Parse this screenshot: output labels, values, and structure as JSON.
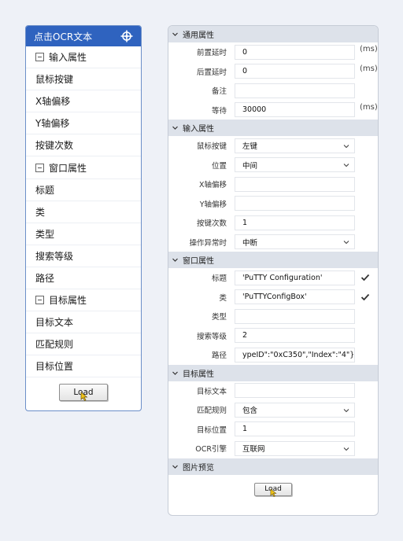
{
  "left": {
    "title": "点击OCR文本",
    "rows": [
      {
        "label": "输入属性",
        "group": true
      },
      {
        "label": "鼠标按键"
      },
      {
        "label": "X轴偏移"
      },
      {
        "label": "Y轴偏移"
      },
      {
        "label": "按键次数"
      },
      {
        "label": "窗口属性",
        "group": true
      },
      {
        "label": "标题"
      },
      {
        "label": "类"
      },
      {
        "label": "类型"
      },
      {
        "label": "搜索等级"
      },
      {
        "label": "路径"
      },
      {
        "label": "目标属性",
        "group": true
      },
      {
        "label": "目标文本"
      },
      {
        "label": "匹配规则"
      },
      {
        "label": "目标位置"
      }
    ],
    "load_label": "Load"
  },
  "right": {
    "sections": [
      {
        "title": "通用属性",
        "rows": [
          {
            "label": "前置延时",
            "value": "0",
            "unit": "(ms)"
          },
          {
            "label": "后置延时",
            "value": "0",
            "unit": "(ms)"
          },
          {
            "label": "备注",
            "value": ""
          },
          {
            "label": "等待",
            "value": "30000",
            "unit": "(ms)"
          }
        ]
      },
      {
        "title": "输入属性",
        "rows": [
          {
            "label": "鼠标按键",
            "value": "左键",
            "select": true
          },
          {
            "label": "位置",
            "value": "中间",
            "select": true
          },
          {
            "label": "X轴偏移",
            "value": ""
          },
          {
            "label": "Y轴偏移",
            "value": ""
          },
          {
            "label": "按键次数",
            "value": "1"
          },
          {
            "label": "操作异常时",
            "value": "中断",
            "select": true
          }
        ]
      },
      {
        "title": "窗口属性",
        "rows": [
          {
            "label": "标题",
            "value": "'PuTTY Configuration'",
            "checked": true
          },
          {
            "label": "类",
            "value": "'PuTTYConfigBox'",
            "checked": true
          },
          {
            "label": "类型",
            "value": ""
          },
          {
            "label": "搜索等级",
            "value": "2"
          },
          {
            "label": "路径",
            "value": "ypeID\":\"0xC350\",\"Index\":\"4\"}])"
          }
        ]
      },
      {
        "title": "目标属性",
        "rows": [
          {
            "label": "目标文本",
            "value": ""
          },
          {
            "label": "匹配规则",
            "value": "包含",
            "select": true
          },
          {
            "label": "目标位置",
            "value": "1"
          },
          {
            "label": "OCR引擎",
            "value": "互联网",
            "select": true
          }
        ]
      },
      {
        "title": "图片预览",
        "rows": []
      }
    ],
    "load_label": "Load"
  },
  "colors": {
    "header_blue": "#2f63bf",
    "section_bg": "#dde2ea",
    "page_bg": "#eef1f7"
  }
}
